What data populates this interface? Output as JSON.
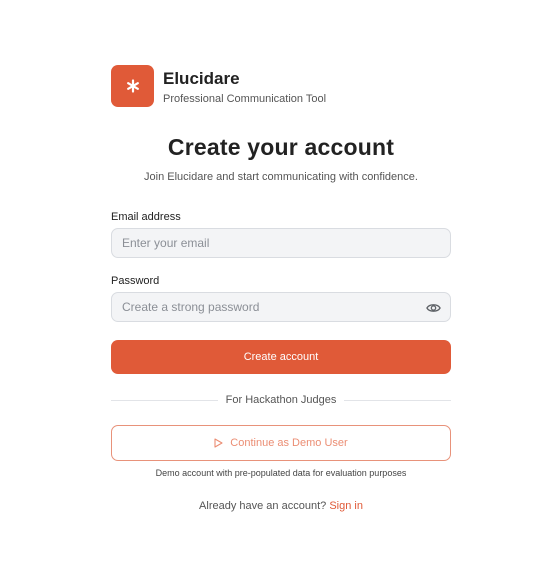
{
  "brand": {
    "name": "Elucidare",
    "tagline": "Professional Communication Tool",
    "logo_glyph": "*",
    "logo_icon": "asterisk-icon",
    "accent_color": "#e05a38"
  },
  "heading": {
    "title": "Create your account",
    "subtitle": "Join Elucidare and start communicating with confidence."
  },
  "form": {
    "email_label": "Email address",
    "email_placeholder": "Enter your email",
    "email_value": "",
    "password_label": "Password",
    "password_placeholder": "Create a strong password",
    "password_value": "",
    "password_toggle_icon": "eye-icon",
    "submit_label": "Create account"
  },
  "demo": {
    "divider_text": "For Hackathon Judges",
    "button_icon": "play-icon",
    "button_label": "Continue as Demo User",
    "note": "Demo account with pre-populated data for evaluation purposes",
    "border_color": "#e8927a"
  },
  "footer": {
    "prompt": "Already have an account?",
    "link_label": "Sign in"
  }
}
